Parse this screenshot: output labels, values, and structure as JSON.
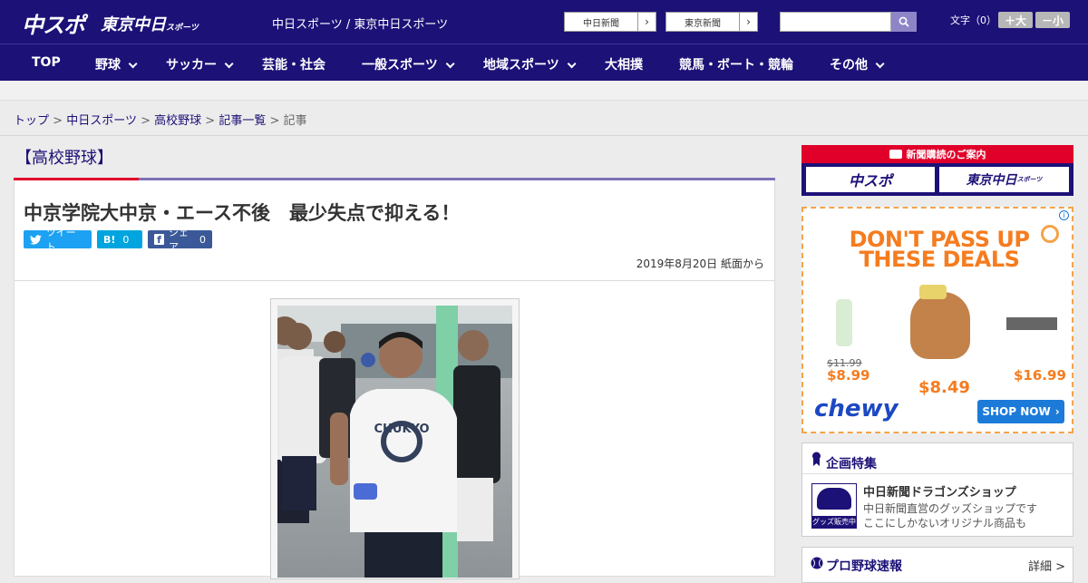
{
  "header": {
    "logo_main": "中スポ",
    "logo_tokyo": "東京中日",
    "logo_tokyo_small": "スポーツ",
    "site_links": "中日スポーツ / 東京中日スポーツ",
    "paper_btn_1": "中日新聞",
    "paper_btn_2": "東京新聞",
    "fontsize_label": "文字（0）",
    "fontsize_up": "＋大",
    "fontsize_down": "－小",
    "search_placeholder": ""
  },
  "nav": [
    {
      "label": "TOP",
      "has_dropdown": false
    },
    {
      "label": "野球",
      "has_dropdown": true
    },
    {
      "label": "サッカー",
      "has_dropdown": true
    },
    {
      "label": "芸能・社会",
      "has_dropdown": false
    },
    {
      "label": "一般スポーツ",
      "has_dropdown": true
    },
    {
      "label": "地域スポーツ",
      "has_dropdown": true
    },
    {
      "label": "大相撲",
      "has_dropdown": false
    },
    {
      "label": "競馬・ボート・競輪",
      "has_dropdown": false
    },
    {
      "label": "その他",
      "has_dropdown": true
    }
  ],
  "breadcrumb": {
    "items": [
      "トップ",
      "中日スポーツ",
      "高校野球",
      "記事一覧"
    ],
    "current": "記事",
    "separator": ">"
  },
  "article": {
    "section": "【高校野球】",
    "headline": "中京学院大中京・エース不後　最少失点で抑える！",
    "tweet_label": "ツイート",
    "hatena_label": "B!",
    "hatena_count": "0",
    "fb_label": "シェア",
    "fb_count": "0",
    "dateline": "2019年8月20日 紙面から"
  },
  "sidebar": {
    "subscribe_banner": "新聞購読のご案内",
    "sub_logo_1": "中スポ",
    "sub_logo_2": "東京中日",
    "sub_logo_2_small": "スポーツ",
    "ad": {
      "line1": "DON'T PASS UP",
      "line2": "THESE DEALS",
      "old_price": "$11.99",
      "price1": "$8.99",
      "price2": "$8.49",
      "price3": "$16.99",
      "brand": "chewy",
      "cta": "SHOP NOW"
    },
    "feature": {
      "title": "企画特集",
      "shop_title": "中日新聞ドラゴンズショップ",
      "shop_desc_1": "中日新聞直営のグッズショップです",
      "shop_desc_2": "ここにしかないオリジナル商品も",
      "thumb_label": "グッズ販売中"
    },
    "score": {
      "title": "プロ野球速報",
      "more": "詳細 >"
    }
  },
  "colors": {
    "brand_navy": "#1c1177",
    "accent_red": "#e0002a",
    "accent_purple": "#7d72b7",
    "twitter": "#1da1f2",
    "hatena": "#00a4de",
    "facebook": "#3b5998"
  }
}
